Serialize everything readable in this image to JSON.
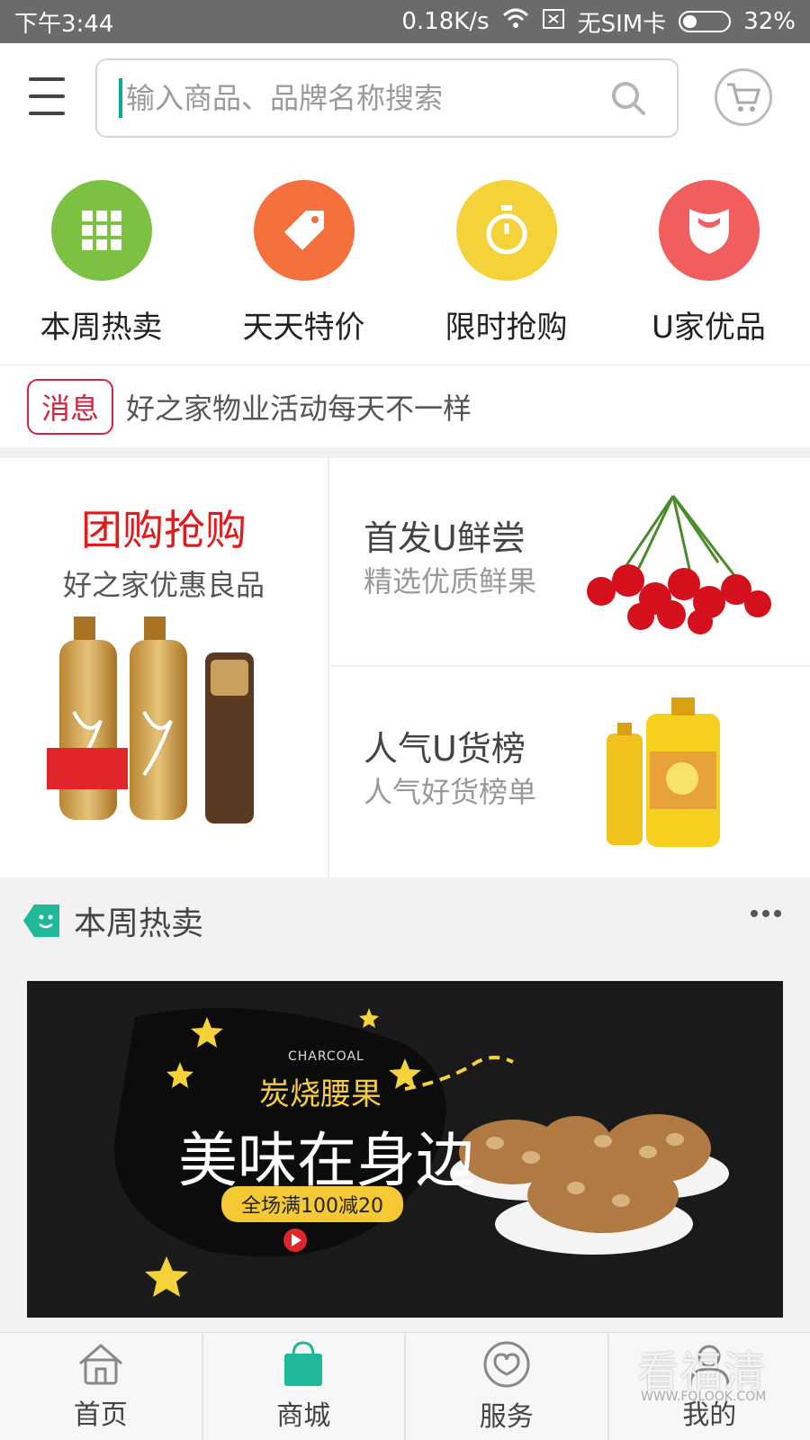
{
  "status_bar": {
    "time": "下午3:44",
    "network_speed": "0.18K/s",
    "sim": "无SIM卡",
    "battery": "32%",
    "battery_level": 0.32
  },
  "header": {
    "search_placeholder": "输入商品、品牌名称搜索",
    "icons": {
      "menu": "menu-icon",
      "search": "search-icon",
      "cart": "cart-icon"
    }
  },
  "categories": [
    {
      "label": "本周热卖",
      "color": "#7cc142",
      "icon": "grid-icon"
    },
    {
      "label": "天天特价",
      "color": "#f5703d",
      "icon": "price-tag-icon"
    },
    {
      "label": "限时抢购",
      "color": "#f4d23a",
      "icon": "stopwatch-icon"
    },
    {
      "label": "U家优品",
      "color": "#f25e5e",
      "icon": "shield-icon"
    }
  ],
  "news": {
    "tag": "消息",
    "text": "好之家物业活动每天不一样",
    "tag_color": "#d4213d"
  },
  "promo": {
    "left": {
      "title": "团购抢购",
      "subtitle": "好之家优惠良品",
      "title_color": "#e21a1a"
    },
    "right_top": {
      "title": "首发U鲜尝",
      "subtitle": "精选优质鲜果"
    },
    "right_bottom": {
      "title": "人气U货榜",
      "subtitle": "人气好货榜单"
    }
  },
  "hot_section": {
    "title": "本周热卖",
    "banner": {
      "charcoal": "CHARCOAL",
      "subtitle": "炭烧腰果",
      "headline": "美味在身边",
      "pill": "全场满100减20"
    }
  },
  "bottom_nav": [
    {
      "label": "首页",
      "icon": "home-icon"
    },
    {
      "label": "商城",
      "icon": "shopping-bag-icon",
      "active": true
    },
    {
      "label": "服务",
      "icon": "service-icon"
    },
    {
      "label": "我的",
      "icon": "user-icon"
    }
  ],
  "watermark": {
    "text": "看福清",
    "sub": "WWW.FQLOOK.COM"
  },
  "colors": {
    "accent": "#1fb99a",
    "brand_red": "#e21a1a"
  }
}
